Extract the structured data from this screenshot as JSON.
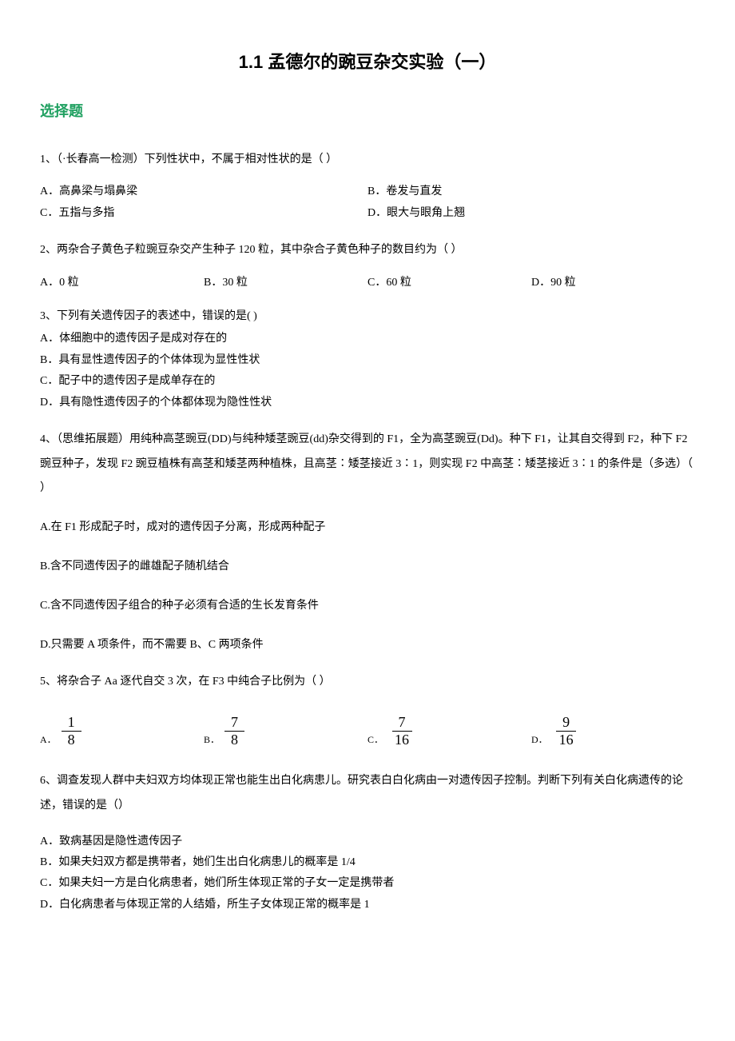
{
  "title": "1.1 孟德尔的豌豆杂交实验（一）",
  "section": "选择题",
  "q1": {
    "text": "1、（·长春高一检测）下列性状中，不属于相对性状的是（ ）",
    "a": "A．高鼻梁与塌鼻梁",
    "b": "B．卷发与直发",
    "c": "C．五指与多指",
    "d": "D．眼大与眼角上翘"
  },
  "q2": {
    "text": "2、两杂合子黄色子粒豌豆杂交产生种子 120 粒，其中杂合子黄色种子的数目约为（ ）",
    "a": "A．0 粒",
    "b": "B．30 粒",
    "c": "C．60 粒",
    "d": "D．90 粒"
  },
  "q3": {
    "text": "3、下列有关遗传因子的表述中，错误的是( )",
    "a": "A．体细胞中的遗传因子是成对存在的",
    "b": "B．具有显性遗传因子的个体体现为显性性状",
    "c": "C．配子中的遗传因子是成单存在的",
    "d": "D．具有隐性遗传因子的个体都体现为隐性性状"
  },
  "q4": {
    "text": "4、（思维拓展题）用纯种高茎豌豆(DD)与纯种矮茎豌豆(dd)杂交得到的 F1，全为高茎豌豆(Dd)。种下 F1，让其自交得到 F2，种下 F2 豌豆种子，发现 F2 豌豆植株有高茎和矮茎两种植株，且高茎∶矮茎接近 3∶1，则实现 F2 中高茎∶矮茎接近 3∶1 的条件是（多选）（ ）",
    "a": "A.在 F1 形成配子时，成对的遗传因子分离，形成两种配子",
    "b": "B.含不同遗传因子的雌雄配子随机结合",
    "c": "C.含不同遗传因子组合的种子必须有合适的生长发育条件",
    "d": "D.只需要 A 项条件，而不需要 B、C 两项条件"
  },
  "q5": {
    "text": "5、将杂合子 Aa 逐代自交 3 次，在 F3 中纯合子比例为（ ）",
    "a_label": "A．",
    "a_num": "1",
    "a_den": "8",
    "b_label": "B．",
    "b_num": "7",
    "b_den": "8",
    "c_label": "C．",
    "c_num": "7",
    "c_den": "16",
    "d_label": "D．",
    "d_num": "9",
    "d_den": "16"
  },
  "q6": {
    "text": "6、调查发现人群中夫妇双方均体现正常也能生出白化病患儿。研究表白白化病由一对遗传因子控制。判断下列有关白化病遗传的论述，错误的是（）",
    "a": "A．致病基因是隐性遗传因子",
    "b": "B．如果夫妇双方都是携带者，她们生出白化病患儿的概率是 1/4",
    "c": "C．如果夫妇一方是白化病患者，她们所生体现正常的子女一定是携带者",
    "d": "D．白化病患者与体现正常的人结婚，所生子女体现正常的概率是 1"
  }
}
